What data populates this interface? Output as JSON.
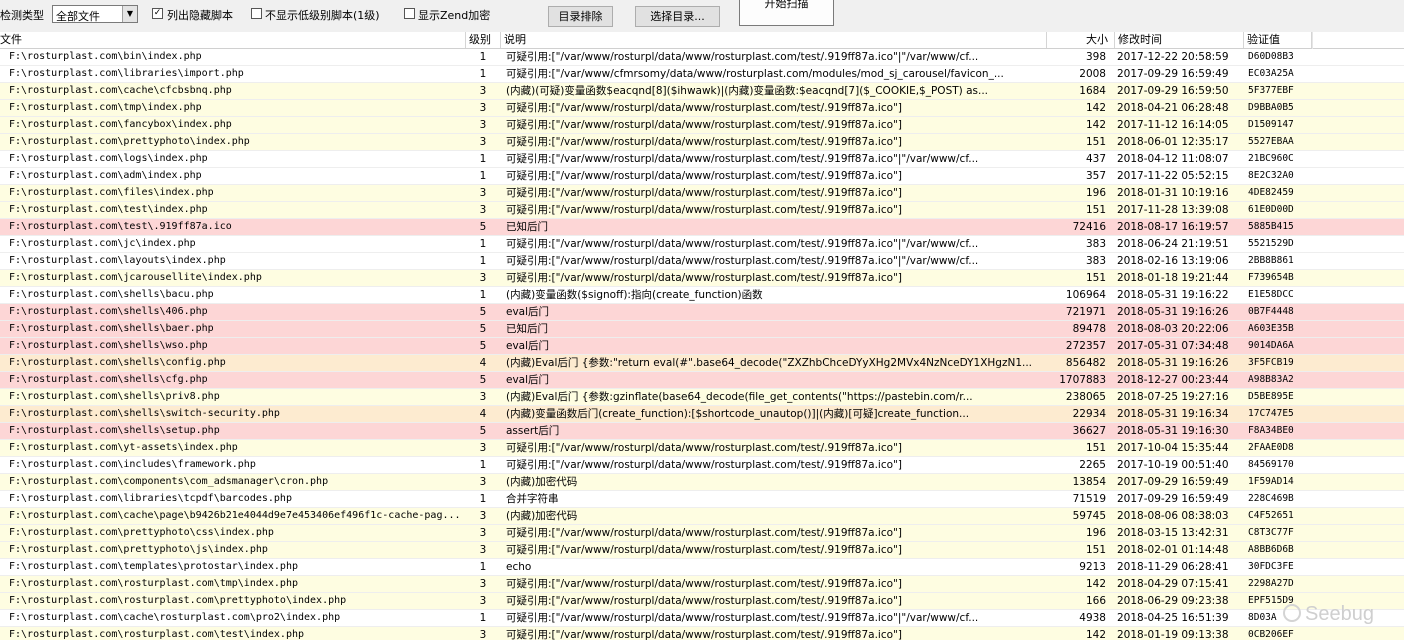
{
  "toolbar": {
    "detect_type_label": "检测类型",
    "detect_type_value": "全部文件",
    "show_hidden_label": "列出隐藏脚本",
    "show_hidden_checked": true,
    "hide_low_label": "不显示低级别脚本(1级)",
    "hide_low_checked": false,
    "show_zend_label": "显示Zend加密",
    "show_zend_checked": false,
    "exclude_dir_label": "目录排除",
    "select_dir_label": "选择目录...",
    "start_scan_label": "开始扫描"
  },
  "columns": {
    "file": "文件",
    "level": "级别",
    "desc": "说明",
    "size": "大小",
    "time": "修改时间",
    "hash": "验证值"
  },
  "rows": [
    {
      "file": "F:\\rosturplast.com\\bin\\index.php",
      "level": "1",
      "desc": "可疑引用:[\"/var/www/rosturpl/data/www/rosturplast.com/test/.919ff87a.ico\"|\"/var/www/cf...",
      "size": "398",
      "time": "2017-12-22 20:58:59",
      "hash": "D60D08B3"
    },
    {
      "file": "F:\\rosturplast.com\\libraries\\import.php",
      "level": "1",
      "desc": "可疑引用:[\"/var/www/cfmrsomy/data/www/rosturplast.com/modules/mod_sj_carousel/favicon_...",
      "size": "2008",
      "time": "2017-09-29 16:59:49",
      "hash": "EC03A25A"
    },
    {
      "file": "F:\\rosturplast.com\\cache\\cfcbsbnq.php",
      "level": "3",
      "desc": "(内藏)(可疑)变量函数$eacqnd[8]($ihwawk)|(内藏)变量函数:$eacqnd[7]($_COOKIE,$_POST)  as...",
      "size": "1684",
      "time": "2017-09-29 16:59:50",
      "hash": "5F377EBF"
    },
    {
      "file": "F:\\rosturplast.com\\tmp\\index.php",
      "level": "3",
      "desc": "可疑引用:[\"/var/www/rosturpl/data/www/rosturplast.com/test/.919ff87a.ico\"]",
      "size": "142",
      "time": "2018-04-21 06:28:48",
      "hash": "D9BBA0B5"
    },
    {
      "file": "F:\\rosturplast.com\\fancybox\\index.php",
      "level": "3",
      "desc": "可疑引用:[\"/var/www/rosturpl/data/www/rosturplast.com/test/.919ff87a.ico\"]",
      "size": "142",
      "time": "2017-11-12 16:14:05",
      "hash": "D1509147"
    },
    {
      "file": "F:\\rosturplast.com\\prettyphoto\\index.php",
      "level": "3",
      "desc": "可疑引用:[\"/var/www/rosturpl/data/www/rosturplast.com/test/.919ff87a.ico\"]",
      "size": "151",
      "time": "2018-06-01 12:35:17",
      "hash": "5527EBAA"
    },
    {
      "file": "F:\\rosturplast.com\\logs\\index.php",
      "level": "1",
      "desc": "可疑引用:[\"/var/www/rosturpl/data/www/rosturplast.com/test/.919ff87a.ico\"|\"/var/www/cf...",
      "size": "437",
      "time": "2018-04-12 11:08:07",
      "hash": "21BC960C"
    },
    {
      "file": "F:\\rosturplast.com\\adm\\index.php",
      "level": "1",
      "desc": "可疑引用:[\"/var/www/rosturpl/data/www/rosturplast.com/test/.919ff87a.ico\"]",
      "size": "357",
      "time": "2017-11-22 05:52:15",
      "hash": "8E2C32A0"
    },
    {
      "file": "F:\\rosturplast.com\\files\\index.php",
      "level": "3",
      "desc": "可疑引用:[\"/var/www/rosturpl/data/www/rosturplast.com/test/.919ff87a.ico\"]",
      "size": "196",
      "time": "2018-01-31 10:19:16",
      "hash": "4DE82459"
    },
    {
      "file": "F:\\rosturplast.com\\test\\index.php",
      "level": "3",
      "desc": "可疑引用:[\"/var/www/rosturpl/data/www/rosturplast.com/test/.919ff87a.ico\"]",
      "size": "151",
      "time": "2017-11-28 13:39:08",
      "hash": "61E0D00D"
    },
    {
      "file": "F:\\rosturplast.com\\test\\.919ff87a.ico",
      "level": "5",
      "desc": "已知后门",
      "size": "72416",
      "time": "2018-08-17 16:19:57",
      "hash": "5885B415"
    },
    {
      "file": "F:\\rosturplast.com\\jc\\index.php",
      "level": "1",
      "desc": "可疑引用:[\"/var/www/rosturpl/data/www/rosturplast.com/test/.919ff87a.ico\"|\"/var/www/cf...",
      "size": "383",
      "time": "2018-06-24 21:19:51",
      "hash": "5521529D"
    },
    {
      "file": "F:\\rosturplast.com\\layouts\\index.php",
      "level": "1",
      "desc": "可疑引用:[\"/var/www/rosturpl/data/www/rosturplast.com/test/.919ff87a.ico\"|\"/var/www/cf...",
      "size": "383",
      "time": "2018-02-16 13:19:06",
      "hash": "2BB8B861"
    },
    {
      "file": "F:\\rosturplast.com\\jcarousellite\\index.php",
      "level": "3",
      "desc": "可疑引用:[\"/var/www/rosturpl/data/www/rosturplast.com/test/.919ff87a.ico\"]",
      "size": "151",
      "time": "2018-01-18 19:21:44",
      "hash": "F739654B"
    },
    {
      "file": "F:\\rosturplast.com\\shells\\bacu.php",
      "level": "1",
      "desc": "(内藏)变量函数($signoff):指向(create_function)函数",
      "size": "106964",
      "time": "2018-05-31 19:16:22",
      "hash": "E1E58DCC"
    },
    {
      "file": "F:\\rosturplast.com\\shells\\406.php",
      "level": "5",
      "desc": "eval后门",
      "size": "721971",
      "time": "2018-05-31 19:16:26",
      "hash": "0B7F4448"
    },
    {
      "file": "F:\\rosturplast.com\\shells\\baer.php",
      "level": "5",
      "desc": "已知后门",
      "size": "89478",
      "time": "2018-08-03 20:22:06",
      "hash": "A603E35B"
    },
    {
      "file": "F:\\rosturplast.com\\shells\\wso.php",
      "level": "5",
      "desc": "eval后门",
      "size": "272357",
      "time": "2017-05-31 07:34:48",
      "hash": "9014DA6A"
    },
    {
      "file": "F:\\rosturplast.com\\shells\\config.php",
      "level": "4",
      "desc": "(内藏)Eval后门 {参数:\"return eval(#\".base64_decode(\"ZXZhbChceDYyXHg2MVx4NzNceDY1XHgzN1...",
      "size": "856482",
      "time": "2018-05-31 19:16:26",
      "hash": "3F5FCB19"
    },
    {
      "file": "F:\\rosturplast.com\\shells\\cfg.php",
      "level": "5",
      "desc": "eval后门",
      "size": "1707883",
      "time": "2018-12-27 00:23:44",
      "hash": "A98B83A2"
    },
    {
      "file": "F:\\rosturplast.com\\shells\\priv8.php",
      "level": "3",
      "desc": "(内藏)Eval后门 {参数:gzinflate(base64_decode(file_get_contents(\"https://pastebin.com/r...",
      "size": "238065",
      "time": "2018-07-25 19:27:16",
      "hash": "D5BE895E"
    },
    {
      "file": "F:\\rosturplast.com\\shells\\switch-security.php",
      "level": "4",
      "desc": "(内藏)变量函数后门(create_function):[$shortcode_unautop()]|(内藏)[可疑]create_function...",
      "size": "22934",
      "time": "2018-05-31 19:16:34",
      "hash": "17C747E5"
    },
    {
      "file": "F:\\rosturplast.com\\shells\\setup.php",
      "level": "5",
      "desc": "assert后门",
      "size": "36627",
      "time": "2018-05-31 19:16:30",
      "hash": "F8A34BE0"
    },
    {
      "file": "F:\\rosturplast.com\\yt-assets\\index.php",
      "level": "3",
      "desc": "可疑引用:[\"/var/www/rosturpl/data/www/rosturplast.com/test/.919ff87a.ico\"]",
      "size": "151",
      "time": "2017-10-04 15:35:44",
      "hash": "2FAAE0D8"
    },
    {
      "file": "F:\\rosturplast.com\\includes\\framework.php",
      "level": "1",
      "desc": "可疑引用:[\"/var/www/rosturpl/data/www/rosturplast.com/test/.919ff87a.ico\"]",
      "size": "2265",
      "time": "2017-10-19 00:51:40",
      "hash": "84569170"
    },
    {
      "file": "F:\\rosturplast.com\\components\\com_adsmanager\\cron.php",
      "level": "3",
      "desc": "(内藏)加密代码",
      "size": "13854",
      "time": "2017-09-29 16:59:49",
      "hash": "1F59AD14"
    },
    {
      "file": "F:\\rosturplast.com\\libraries\\tcpdf\\barcodes.php",
      "level": "1",
      "desc": "合并字符串",
      "size": "71519",
      "time": "2017-09-29 16:59:49",
      "hash": "228C469B"
    },
    {
      "file": "F:\\rosturplast.com\\cache\\page\\b9426b21e4044d9e7e453406ef496f1c-cache-pag...",
      "level": "3",
      "desc": "(内藏)加密代码",
      "size": "59745",
      "time": "2018-08-06 08:38:03",
      "hash": "C4F52651"
    },
    {
      "file": "F:\\rosturplast.com\\prettyphoto\\css\\index.php",
      "level": "3",
      "desc": "可疑引用:[\"/var/www/rosturpl/data/www/rosturplast.com/test/.919ff87a.ico\"]",
      "size": "196",
      "time": "2018-03-15 13:42:31",
      "hash": "C8T3C77F"
    },
    {
      "file": "F:\\rosturplast.com\\prettyphoto\\js\\index.php",
      "level": "3",
      "desc": "可疑引用:[\"/var/www/rosturpl/data/www/rosturplast.com/test/.919ff87a.ico\"]",
      "size": "151",
      "time": "2018-02-01 01:14:48",
      "hash": "A8BB6D6B"
    },
    {
      "file": "F:\\rosturplast.com\\templates\\protostar\\index.php",
      "level": "1",
      "desc": "echo",
      "size": "9213",
      "time": "2018-11-29 06:28:41",
      "hash": "30FDC3FE"
    },
    {
      "file": "F:\\rosturplast.com\\rosturplast.com\\tmp\\index.php",
      "level": "3",
      "desc": "可疑引用:[\"/var/www/rosturpl/data/www/rosturplast.com/test/.919ff87a.ico\"]",
      "size": "142",
      "time": "2018-04-29 07:15:41",
      "hash": "2298A27D"
    },
    {
      "file": "F:\\rosturplast.com\\rosturplast.com\\prettyphoto\\index.php",
      "level": "3",
      "desc": "可疑引用:[\"/var/www/rosturpl/data/www/rosturplast.com/test/.919ff87a.ico\"]",
      "size": "166",
      "time": "2018-06-29 09:23:38",
      "hash": "EPF515D9"
    },
    {
      "file": "F:\\rosturplast.com\\cache\\rosturplast.com\\pro2\\index.php",
      "level": "1",
      "desc": "可疑引用:[\"/var/www/rosturpl/data/www/rosturplast.com/test/.919ff87a.ico\"|\"/var/www/cf...",
      "size": "4938",
      "time": "2018-04-25 16:51:39",
      "hash": "8D03A"
    },
    {
      "file": "F:\\rosturplast.com\\rosturplast.com\\test\\index.php",
      "level": "3",
      "desc": "可疑引用:[\"/var/www/rosturpl/data/www/rosturplast.com/test/.919ff87a.ico\"]",
      "size": "142",
      "time": "2018-01-19 09:13:38",
      "hash": "0CB206EF"
    }
  ],
  "watermark": "Seebug"
}
